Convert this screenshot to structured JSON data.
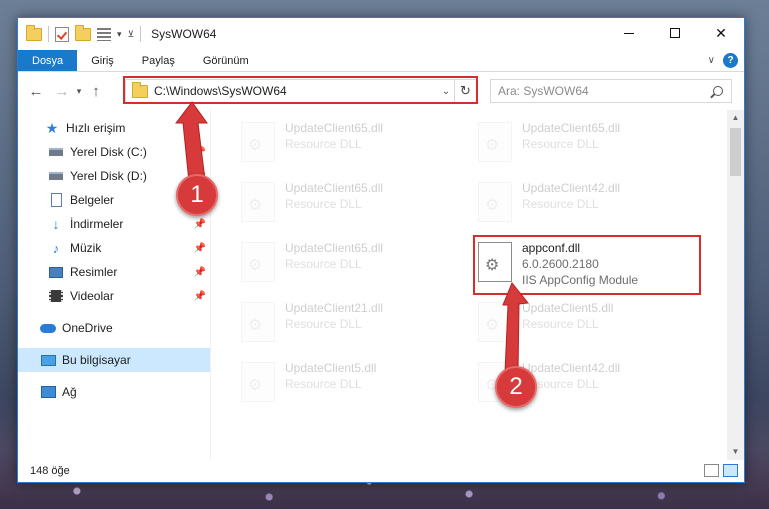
{
  "window": {
    "title": "SysWOW64"
  },
  "ribbon": {
    "tabs": [
      "Dosya",
      "Giriş",
      "Paylaş",
      "Görünüm"
    ]
  },
  "address": {
    "path": "C:\\Windows\\SysWOW64",
    "search_placeholder": "Ara: SysWOW64"
  },
  "nav": {
    "items": [
      {
        "label": "Hızlı erişim",
        "icon": "star-icon",
        "pinned": false
      },
      {
        "label": "Yerel Disk (C:)",
        "icon": "drive-icon",
        "pinned": true
      },
      {
        "label": "Yerel Disk (D:)",
        "icon": "drive-icon",
        "pinned": true
      },
      {
        "label": "Belgeler",
        "icon": "document-icon",
        "pinned": true
      },
      {
        "label": "İndirmeler",
        "icon": "download-icon",
        "pinned": true
      },
      {
        "label": "Müzik",
        "icon": "music-icon",
        "pinned": true
      },
      {
        "label": "Resimler",
        "icon": "picture-icon",
        "pinned": true
      },
      {
        "label": "Videolar",
        "icon": "video-icon",
        "pinned": true
      },
      {
        "label": "OneDrive",
        "icon": "cloud-icon",
        "pinned": false
      },
      {
        "label": "Bu bilgisayar",
        "icon": "computer-icon",
        "pinned": false
      },
      {
        "label": "Ağ",
        "icon": "network-icon",
        "pinned": false
      }
    ]
  },
  "files": [
    {
      "name": "UpdateClient65.dll",
      "type": "Resource DLL"
    },
    {
      "name": "UpdateClient65.dll",
      "type": "Resource DLL"
    },
    {
      "name": "UpdateClient65.dll",
      "type": "Resource DLL"
    },
    {
      "name": "UpdateClient42.dll",
      "type": "Resource DLL"
    },
    {
      "name": "UpdateClient65.dll",
      "type": "Resource DLL"
    },
    {
      "name": "appconf.dll",
      "version": "6.0.2600.2180",
      "description": "IIS AppConfig Module"
    },
    {
      "name": "UpdateClient21.dll",
      "type": "Resource DLL"
    },
    {
      "name": "UpdateClient5.dll",
      "type": "Resource DLL"
    },
    {
      "name": "UpdateClient5.dll",
      "type": "Resource DLL"
    },
    {
      "name": "UpdateClient42.dll",
      "type": "Resource DLL"
    }
  ],
  "status": {
    "count": "148 öğe"
  },
  "callouts": [
    "1",
    "2"
  ],
  "colors": {
    "accent": "#1979ca",
    "highlight": "#d62d2d",
    "selected": "#cce8ff"
  }
}
